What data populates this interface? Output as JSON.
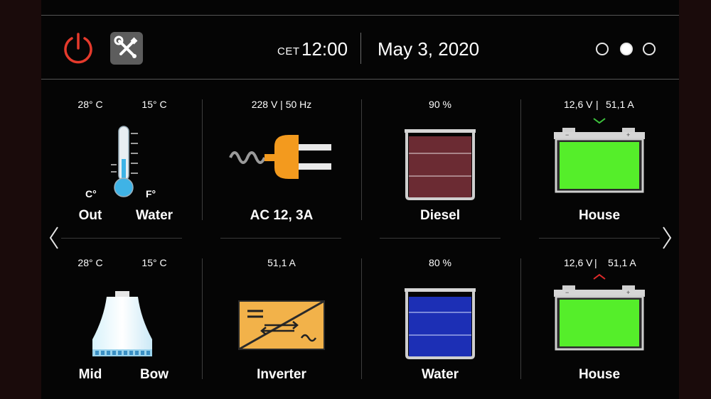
{
  "header": {
    "timezone": "CET",
    "time": "12:00",
    "date": "May 3, 2020",
    "page_dots": 3,
    "active_page": 2
  },
  "tiles": {
    "temperature": {
      "out_value": "28° C",
      "water_value": "15° C",
      "unit_left": "C°",
      "unit_right": "F°",
      "label_left": "Out",
      "label_right": "Water"
    },
    "ac": {
      "reading": "228 V | 50 Hz",
      "label": "AC 12, 3A"
    },
    "diesel": {
      "reading": "90 %",
      "level": 0.9,
      "label": "Diesel"
    },
    "house1": {
      "voltage": "12,6 V",
      "current": "51,1 A",
      "label": "House"
    },
    "heater": {
      "mid_value": "28° C",
      "bow_value": "15° C",
      "label_left": "Mid",
      "label_right": "Bow"
    },
    "inverter": {
      "reading": "51,1 A",
      "label": "Inverter"
    },
    "water": {
      "reading": "80 %",
      "level": 0.8,
      "label": "Water"
    },
    "house2": {
      "voltage": "12,6 V",
      "current": "51,1 A",
      "label": "House"
    }
  },
  "colors": {
    "power": "#e53a2c",
    "thermometer": "#3fb3e6",
    "plug": "#f39a1e",
    "diesel": "#6b2b33",
    "water": "#1c2fb5",
    "battery": "#55ee2a",
    "charge_indicator": "#3ec43e",
    "discharge_indicator": "#e02a2a",
    "inverter": "#f2b24a"
  }
}
